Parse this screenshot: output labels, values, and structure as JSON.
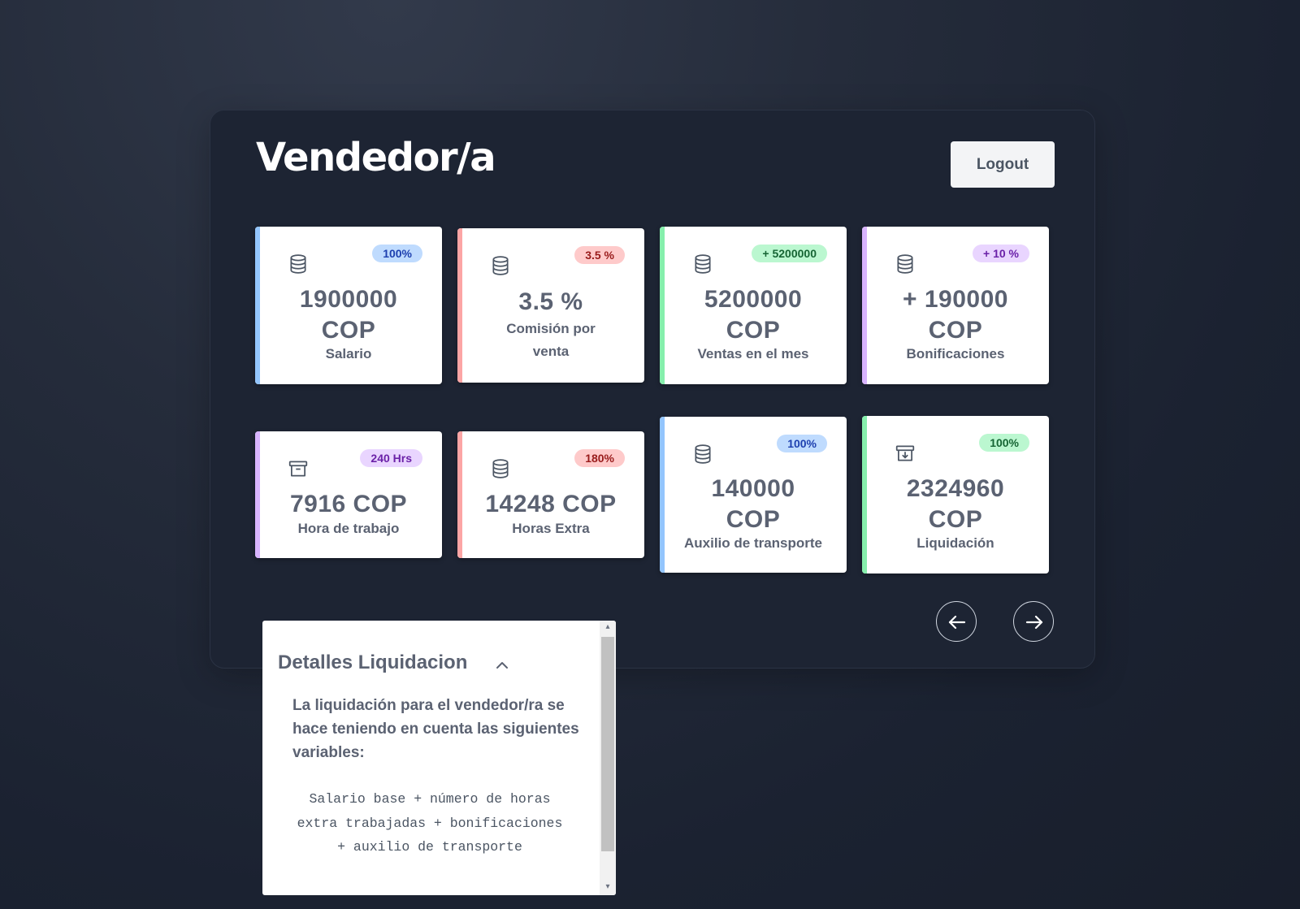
{
  "header": {
    "title": "Vendedor/a",
    "logout_label": "Logout"
  },
  "cards": [
    {
      "badge": "100%",
      "value": "1900000 COP",
      "label": "Salario",
      "icon": "coins-icon",
      "accent": "#93c5fd",
      "badge_bg": "#bfdbfe",
      "badge_fg": "#1e40af"
    },
    {
      "badge": "3.5 %",
      "value": "3.5 %",
      "label": "Comisión por venta",
      "icon": "coins-icon",
      "accent": "#fca5a5",
      "badge_bg": "#fecaca",
      "badge_fg": "#991b1b"
    },
    {
      "badge": "+ 5200000",
      "value": "5200000 COP",
      "label": "Ventas en el mes",
      "icon": "coins-icon",
      "accent": "#86efac",
      "badge_bg": "#bbf7d0",
      "badge_fg": "#166534"
    },
    {
      "badge": "+ 10 %",
      "value": "+ 190000 COP",
      "label": "Bonificaciones",
      "icon": "coins-icon",
      "accent": "#d8b4fe",
      "badge_bg": "#e9d5ff",
      "badge_fg": "#6b21a8"
    },
    {
      "badge": "240 Hrs",
      "value": "7916 COP",
      "label": "Hora de trabajo",
      "icon": "archive-icon",
      "accent": "#d8b4fe",
      "badge_bg": "#e9d5ff",
      "badge_fg": "#6b21a8"
    },
    {
      "badge": "180%",
      "value": "14248 COP",
      "label": "Horas Extra",
      "icon": "coins-icon",
      "accent": "#fca5a5",
      "badge_bg": "#fecaca",
      "badge_fg": "#991b1b"
    },
    {
      "badge": "100%",
      "value": "140000 COP",
      "label": "Auxilio de transporte",
      "icon": "coins-icon",
      "accent": "#93c5fd",
      "badge_bg": "#bfdbfe",
      "badge_fg": "#1e40af"
    },
    {
      "badge": "100%",
      "value": "2324960 COP",
      "label": "Liquidación",
      "icon": "archive-download-icon",
      "accent": "#86efac",
      "badge_bg": "#bbf7d0",
      "badge_fg": "#166534"
    }
  ],
  "navigation": {
    "prev_icon": "arrow-left-icon",
    "next_icon": "arrow-right-icon"
  },
  "details": {
    "title": "Detalles Liquidacion",
    "description": "La liquidación para el vendedor/ra se hace teniendo en cuenta las siguientes variables:",
    "formula": "Salario base + número de horas extra trabajadas + bonificaciones + auxilio de transporte"
  }
}
